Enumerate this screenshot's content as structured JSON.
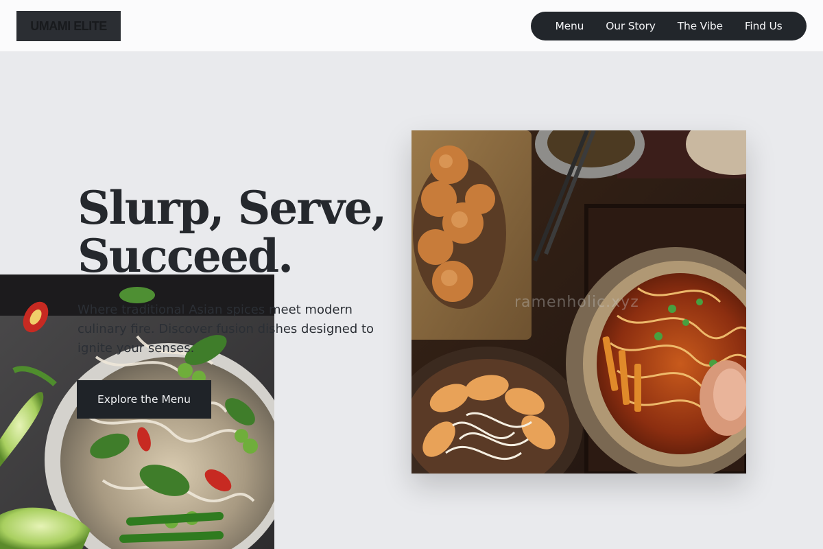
{
  "brand": {
    "logo_text": "UMAMI ELITE"
  },
  "nav": {
    "items": [
      {
        "label": "Menu"
      },
      {
        "label": "Our Story"
      },
      {
        "label": "The Vibe"
      },
      {
        "label": "Find Us"
      }
    ]
  },
  "hero": {
    "title": "Slurp, Serve, Succeed.",
    "subtitle": "Where traditional Asian spices meet modern culinary fire. Discover fusion dishes designed to ignite your senses.",
    "cta_label": "Explore the Menu"
  },
  "images": {
    "left": "pho-bowl-photo",
    "right": "ramen-gyoza-karaage-spread-photo",
    "watermark": "ramenholic.xyz"
  },
  "colors": {
    "page_background": "#e9eaed",
    "header_background": "#fbfbfc",
    "dark": "#1f2328",
    "text": "#25282d"
  }
}
